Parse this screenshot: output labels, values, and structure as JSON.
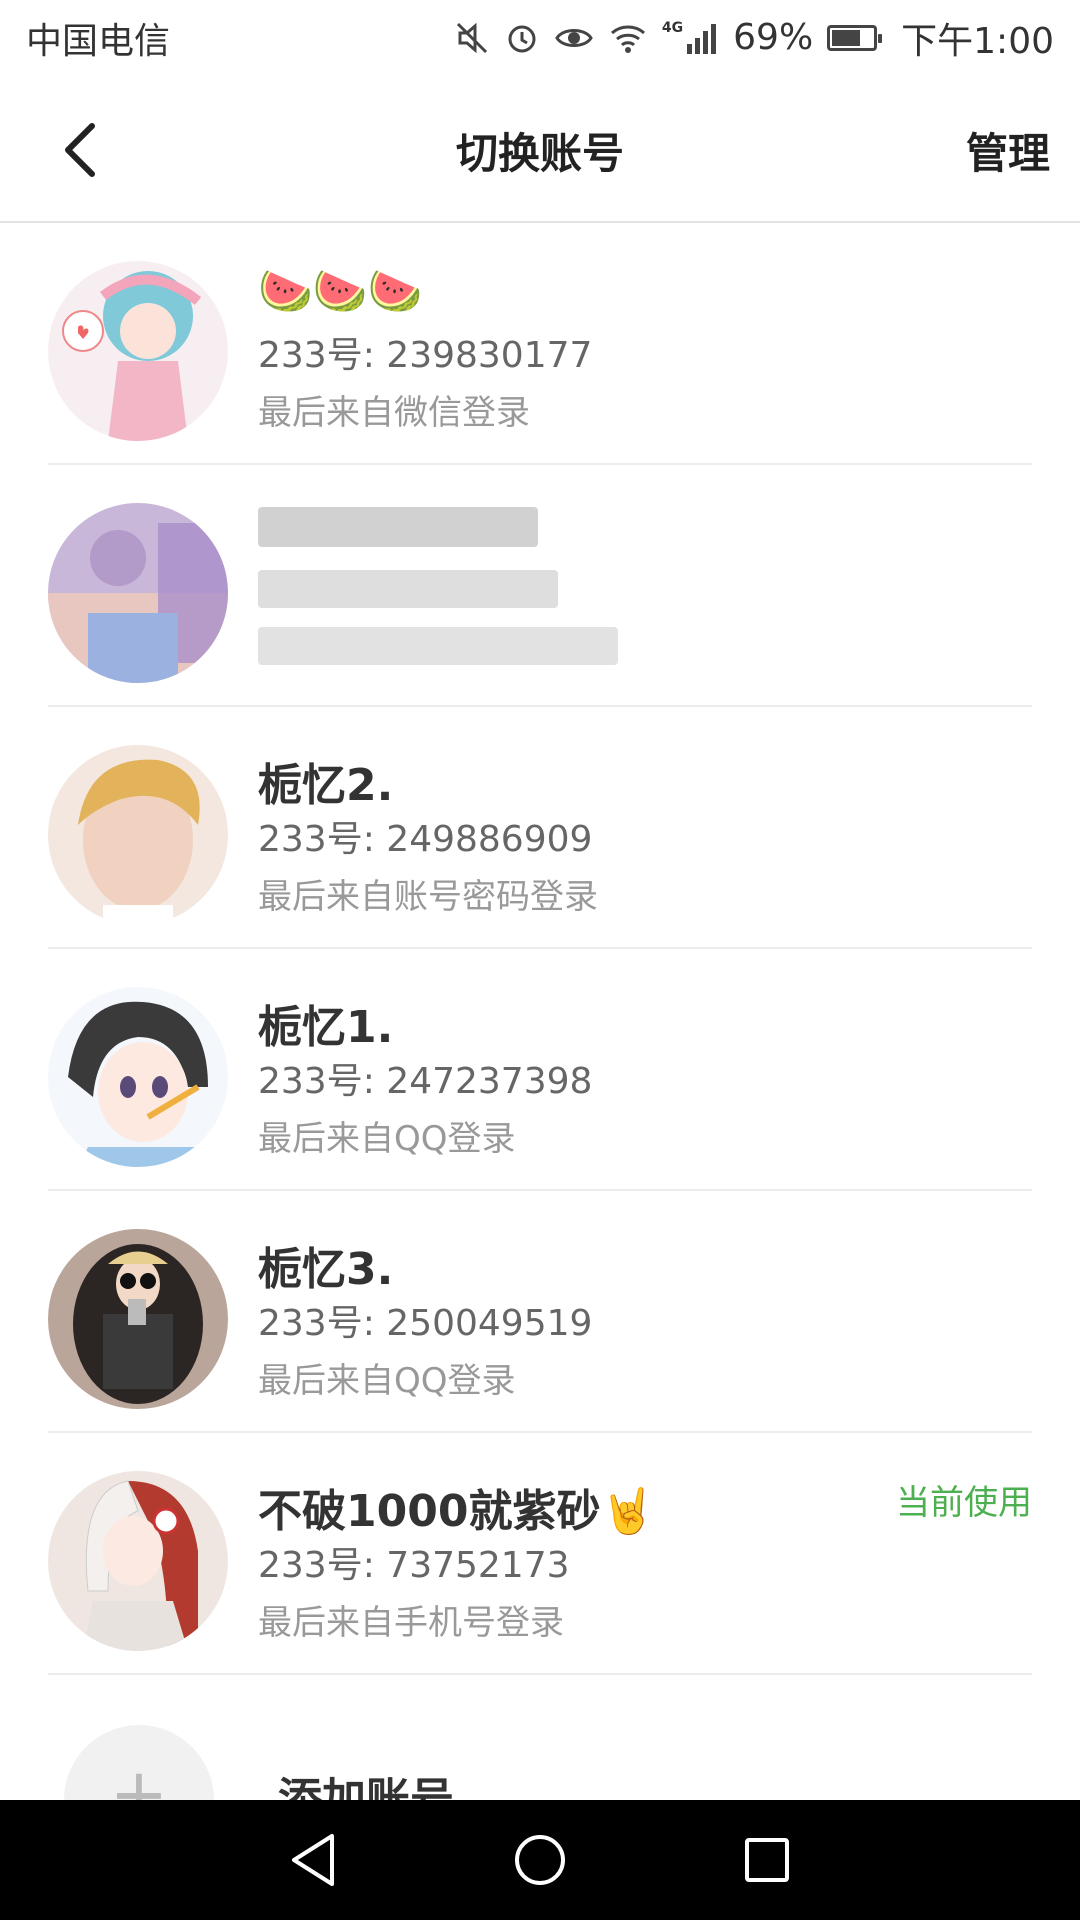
{
  "status_bar": {
    "carrier": "中国电信",
    "battery_level": "69%",
    "battery_fraction": 0.69,
    "time": "下午1:00",
    "network": "4G",
    "icons": [
      "mute-icon",
      "alarm-icon",
      "eye-icon",
      "wifi-icon",
      "signal-icon",
      "battery-icon"
    ]
  },
  "nav": {
    "title": "切换账号",
    "manage_label": "管理",
    "back_icon": "chevron-left-icon"
  },
  "accounts": [
    {
      "name_emoji": "🍉🍉🍉",
      "id": "233号: 239830177",
      "login": "最后来自微信登录",
      "current": false
    },
    {
      "blurred": true,
      "current": false
    },
    {
      "name": "栀忆2.",
      "id": "233号: 249886909",
      "login": "最后来自账号密码登录",
      "current": false
    },
    {
      "name": "栀忆1.",
      "id": "233号: 247237398",
      "login": "最后来自QQ登录",
      "current": false
    },
    {
      "name": "栀忆3.",
      "id": "233号: 250049519",
      "login": "最后来自QQ登录",
      "current": false
    },
    {
      "name": "不破1000就紫砂🤘",
      "id": "233号: 73752173",
      "login": "最后来自手机号登录",
      "current": true,
      "current_label": "当前使用"
    }
  ],
  "add_account": {
    "label": "添加账号",
    "icon": "plus-icon"
  },
  "colors": {
    "current_badge": "#4caf50",
    "divider": "#ececec",
    "system_nav": "#000000"
  },
  "system_nav": [
    "back-triangle-icon",
    "home-circle-icon",
    "recents-square-icon"
  ]
}
